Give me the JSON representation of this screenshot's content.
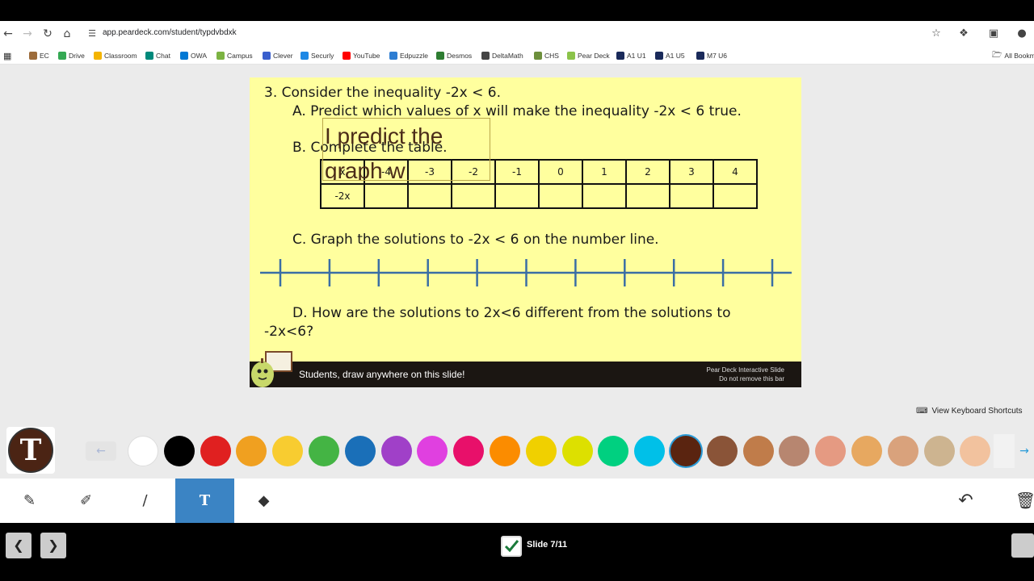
{
  "browser": {
    "url": "app.peardeck.com/student/typdvbdxk",
    "bookmarks": [
      {
        "label": "EC",
        "color": "#9c6b3a"
      },
      {
        "label": "Drive",
        "color": "#34a853"
      },
      {
        "label": "Classroom",
        "color": "#f4b400"
      },
      {
        "label": "Chat",
        "color": "#00897b"
      },
      {
        "label": "OWA",
        "color": "#0078d4"
      },
      {
        "label": "Campus",
        "color": "#7cb342"
      },
      {
        "label": "Clever",
        "color": "#3a5fcd"
      },
      {
        "label": "Securly",
        "color": "#1e88e5"
      },
      {
        "label": "YouTube",
        "color": "#ff0000"
      },
      {
        "label": "Edpuzzle",
        "color": "#2d7dd2"
      },
      {
        "label": "Desmos",
        "color": "#2e7d32"
      },
      {
        "label": "DeltaMath",
        "color": "#444444"
      },
      {
        "label": "CHS",
        "color": "#6d8f3c"
      },
      {
        "label": "Pear Deck",
        "color": "#8bc34a"
      },
      {
        "label": "A1 U1",
        "color": "#1a2a5a"
      },
      {
        "label": "A1 U5",
        "color": "#1a2a5a"
      },
      {
        "label": "M7 U6",
        "color": "#1a2a5a"
      }
    ],
    "all_bookmarks": "All Bookm"
  },
  "slide": {
    "q3": "3.  Consider the inequality -2x < 6.",
    "qA": "A.  Predict which values of x will make the inequality -2x < 6 true.",
    "qB": "B.  Complete the table.",
    "qC": "C.  Graph the solutions to -2x < 6 on the number line.",
    "qD": "D.  How are the solutions to 2x<6 different from the solutions to",
    "qD2": "-2x<6?",
    "table_row1": [
      "x",
      "-4",
      "-3",
      "-2",
      "-1",
      "0",
      "1",
      "2",
      "3",
      "4"
    ],
    "table_row2": [
      "-2x",
      "",
      "",
      "",
      "",
      "",
      "",
      "",
      "",
      ""
    ],
    "student_text_line1": "I predict the",
    "student_text_line2": "graph w",
    "deck_message": "Students, draw anywhere on this slide!",
    "deck_note1": "Pear Deck Interactive Slide",
    "deck_note2": "Do not remove this bar"
  },
  "keyboard_shortcuts": "View Keyboard Shortcuts",
  "tool_badge_letter": "T",
  "palette": [
    {
      "color": "#ffffff",
      "selected": false
    },
    {
      "color": "#000000",
      "selected": false
    },
    {
      "color": "#e02020",
      "selected": false
    },
    {
      "color": "#f0a020",
      "selected": false
    },
    {
      "color": "#f8cc30",
      "selected": false
    },
    {
      "color": "#44b444",
      "selected": false
    },
    {
      "color": "#1a6fb8",
      "selected": false
    },
    {
      "color": "#a040c8",
      "selected": false
    },
    {
      "color": "#e040e0",
      "selected": false
    },
    {
      "color": "#e8106a",
      "selected": false
    },
    {
      "color": "#fb8c00",
      "selected": false
    },
    {
      "color": "#f0d000",
      "selected": false
    },
    {
      "color": "#dde000",
      "selected": false
    },
    {
      "color": "#00d080",
      "selected": false
    },
    {
      "color": "#00c0e8",
      "selected": false
    },
    {
      "color": "#5a2410",
      "selected": true
    },
    {
      "color": "#8a5438",
      "selected": false
    },
    {
      "color": "#c07c4a",
      "selected": false
    },
    {
      "color": "#b78670",
      "selected": false
    },
    {
      "color": "#e59a82",
      "selected": false
    },
    {
      "color": "#e7a860",
      "selected": false
    },
    {
      "color": "#d9a27c",
      "selected": false
    },
    {
      "color": "#cdb490",
      "selected": false
    },
    {
      "color": "#f2c29e",
      "selected": false
    }
  ],
  "toolbar": {
    "tools": [
      "pencil",
      "highlighter",
      "line",
      "text",
      "eraser"
    ],
    "active": "text"
  },
  "footer": {
    "slide_label": "Slide 7/11"
  }
}
